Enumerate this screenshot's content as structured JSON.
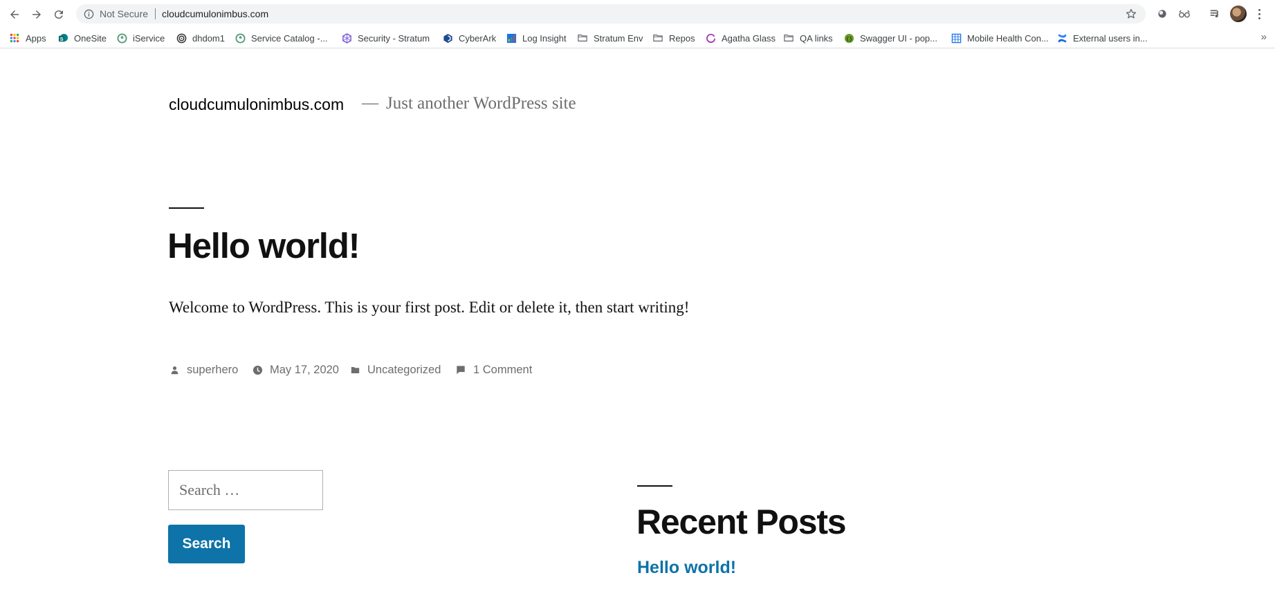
{
  "browser": {
    "address_bar": {
      "security_label": "Not Secure",
      "url": "cloudcumulonimbus.com"
    },
    "bookmarks": [
      {
        "label": "Apps",
        "icon": "apps-grid-icon"
      },
      {
        "label": "OneSite",
        "icon": "sharepoint-icon"
      },
      {
        "label": "iService",
        "icon": "iservice-icon"
      },
      {
        "label": "dhdom1",
        "icon": "dhdom-icon"
      },
      {
        "label": "Service Catalog -...",
        "icon": "service-catalog-icon"
      },
      {
        "label": "Security - Stratum",
        "icon": "stratum-icon"
      },
      {
        "label": "CyberArk",
        "icon": "cyberark-icon"
      },
      {
        "label": "Log Insight",
        "icon": "chart-icon"
      },
      {
        "label": "Stratum Env",
        "icon": "folder-icon"
      },
      {
        "label": "Repos",
        "icon": "folder-icon"
      },
      {
        "label": "Agatha Glass",
        "icon": "agatha-icon"
      },
      {
        "label": "QA links",
        "icon": "folder-icon"
      },
      {
        "label": "Swagger UI - pop...",
        "icon": "swagger-icon"
      },
      {
        "label": "Mobile Health Con...",
        "icon": "spreadsheet-icon"
      },
      {
        "label": "External users in...",
        "icon": "confluence-icon"
      }
    ],
    "bookmarks_overflow": "»"
  },
  "site": {
    "title": "cloudcumulonimbus.com",
    "separator": "—",
    "tagline": "Just another WordPress site"
  },
  "post": {
    "title": "Hello world!",
    "body": "Welcome to WordPress. This is your first post. Edit or delete it, then start writing!",
    "meta": {
      "author": "superhero",
      "date": "May 17, 2020",
      "category": "Uncategorized",
      "comments": "1 Comment"
    }
  },
  "widgets": {
    "search": {
      "placeholder": "Search …",
      "button_label": "Search"
    },
    "recent_posts": {
      "title": "Recent Posts",
      "items": [
        "Hello world!"
      ]
    }
  },
  "colors": {
    "accent": "#0d73a8",
    "text": "#111111",
    "muted": "#6d6d6d"
  }
}
